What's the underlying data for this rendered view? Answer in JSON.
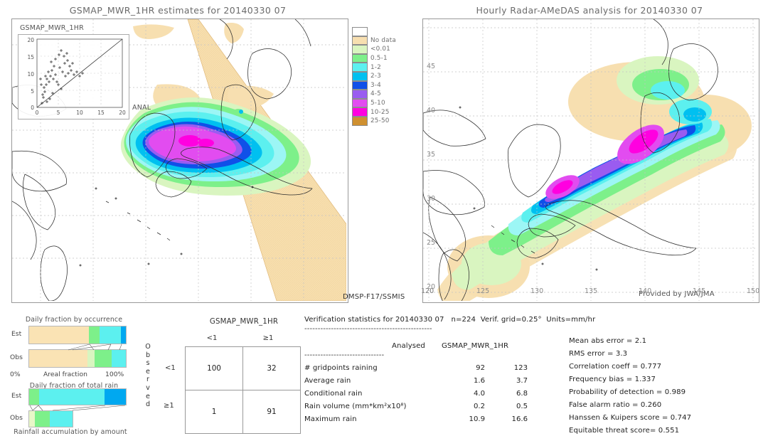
{
  "left_panel": {
    "title": "GSMAP_MWR_1HR estimates for 20140330 07",
    "source_label": "DMSP-F17/SSMIS",
    "inset": {
      "title": "GSMAP_MWR_1HR",
      "xlabel": "ANAL",
      "yticks": [
        "20",
        "15",
        "10",
        "5",
        "0"
      ],
      "xticks": [
        "0",
        "5",
        "10",
        "15",
        "20"
      ]
    }
  },
  "right_panel": {
    "title": "Hourly Radar-AMeDAS analysis for 20140330 07",
    "credit": "Provided by JWA/JMA",
    "xticks": [
      "120",
      "125",
      "130",
      "135",
      "140",
      "145",
      "150"
    ],
    "yticks": [
      "45",
      "40",
      "35",
      "30",
      "25",
      "20"
    ],
    "corner_left": "20"
  },
  "colorbar": {
    "entries": [
      {
        "label": "",
        "color": "#ffffff"
      },
      {
        "label": "No data",
        "color": "#f7dfb0"
      },
      {
        "label": "<0.01",
        "color": "#d9f5c0"
      },
      {
        "label": "0.5-1",
        "color": "#7df08a"
      },
      {
        "label": "1-2",
        "color": "#5cf0ef"
      },
      {
        "label": "2-3",
        "color": "#00c0f0"
      },
      {
        "label": "3-4",
        "color": "#1050e8"
      },
      {
        "label": "4-5",
        "color": "#9a5cf0"
      },
      {
        "label": "5-10",
        "color": "#e24cf0"
      },
      {
        "label": "10-25",
        "color": "#ff00e0"
      },
      {
        "label": "25-50",
        "color": "#cf9030"
      }
    ]
  },
  "occurrence_chart": {
    "title": "Daily fraction by occurrence",
    "xlabel": "Areal fraction",
    "xmin_label": "0%",
    "xmax_label": "100%",
    "rows": [
      {
        "label": "Est",
        "segments": [
          {
            "value": 62,
            "color": "#fae3b4"
          },
          {
            "value": 11,
            "color": "#7df08a"
          },
          {
            "value": 22,
            "color": "#5cf0ef"
          },
          {
            "value": 5,
            "color": "#00a8f0"
          }
        ]
      },
      {
        "label": "Obs",
        "segments": [
          {
            "value": 60,
            "color": "#fae3b4"
          },
          {
            "value": 8,
            "color": "#d9f5c0"
          },
          {
            "value": 17,
            "color": "#7df08a"
          },
          {
            "value": 15,
            "color": "#5cf0ef"
          }
        ]
      }
    ]
  },
  "total_rain_chart": {
    "title": "Daily fraction of total rain",
    "footer": "Rainfall accumulation by amount",
    "rows": [
      {
        "label": "Est",
        "width_pct": 100,
        "segments": [
          {
            "value": 10,
            "color": "#7df08a"
          },
          {
            "value": 68,
            "color": "#5cf0ef"
          },
          {
            "value": 22,
            "color": "#00a8f0"
          }
        ]
      },
      {
        "label": "Obs",
        "width_pct": 46,
        "segments": [
          {
            "value": 13,
            "color": "#e8f7c8"
          },
          {
            "value": 35,
            "color": "#7df08a"
          },
          {
            "value": 52,
            "color": "#5cf0ef"
          }
        ]
      }
    ]
  },
  "contingency": {
    "title": "GSMAP_MWR_1HR",
    "col_headers": [
      "<1",
      "≥1"
    ],
    "row_headers": [
      "<1",
      "≥1"
    ],
    "axis_label": "Observed",
    "cells": [
      [
        "100",
        "32"
      ],
      [
        "1",
        "91"
      ]
    ]
  },
  "stats": {
    "header": "Verification statistics for 20140330 07   n=224  Verif. grid=0.25°  Units=mm/hr",
    "divider": "------------------------------------------------",
    "col_left": "Analysed",
    "col_right": "GSMAP_MWR_1HR",
    "sub_divider": "------------------------------",
    "rows": [
      {
        "label": "# gridpoints raining",
        "analysed": "92",
        "model": "123"
      },
      {
        "label": "Average rain",
        "analysed": "1.6",
        "model": "3.7"
      },
      {
        "label": "Conditional rain",
        "analysed": "4.0",
        "model": "6.8"
      },
      {
        "label": "Rain volume (mm*km²x10⁸)",
        "analysed": "0.2",
        "model": "0.5"
      },
      {
        "label": "Maximum rain",
        "analysed": "10.9",
        "model": "16.6"
      }
    ],
    "scores": [
      "Mean abs error = 2.1",
      "RMS error = 3.3",
      "Correlation coeff = 0.777",
      "Frequency bias = 1.337",
      "Probability of detection = 0.989",
      "False alarm ratio = 0.260",
      "Hanssen & Kuipers score = 0.747",
      "Equitable threat score= 0.551"
    ]
  }
}
